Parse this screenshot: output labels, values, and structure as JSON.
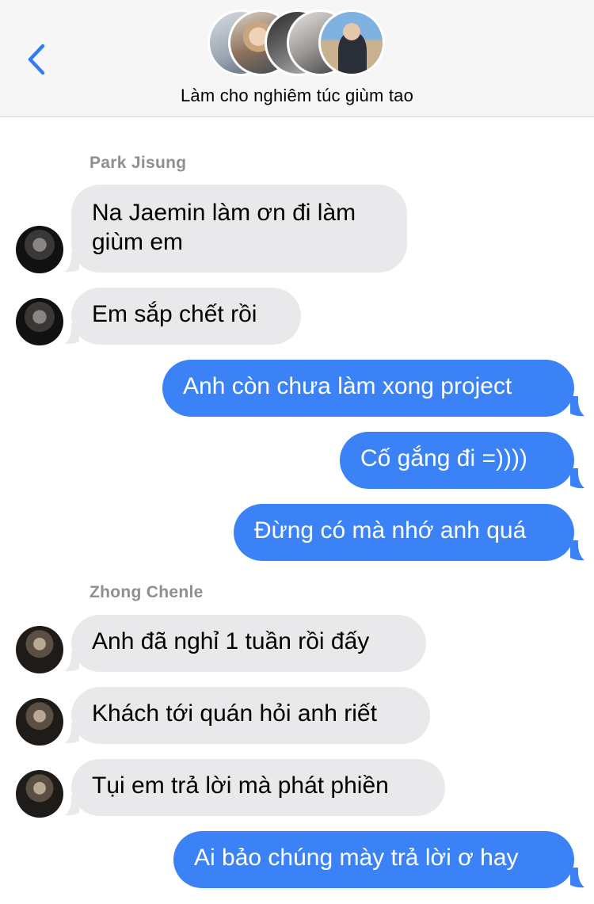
{
  "header": {
    "title": "Làm cho nghiêm túc giùm tao",
    "back_icon": "chevron-left-icon",
    "accent": "#2f7cf6"
  },
  "colors": {
    "outgoing_bubble": "#3b82f6",
    "incoming_bubble": "#e9e9eb",
    "sender_name": "#8e8e93"
  },
  "groups": [
    {
      "sender": "Park Jisung",
      "messages": [
        "Na Jaemin làm ơn đi làm giùm em",
        "Em sắp chết rồi"
      ]
    },
    {
      "sender": "me",
      "messages": [
        "Anh còn chưa làm xong project",
        "Cố gắng đi =))))",
        "Đừng có mà nhớ anh quá"
      ]
    },
    {
      "sender": "Zhong Chenle",
      "messages": [
        "Anh đã nghỉ 1 tuần rồi đấy",
        "Khách tới quán hỏi anh riết",
        "Tụi em trả lời mà phát phiền"
      ]
    },
    {
      "sender": "me",
      "messages": [
        "Ai bảo chúng mày trả lời ơ hay"
      ]
    }
  ]
}
